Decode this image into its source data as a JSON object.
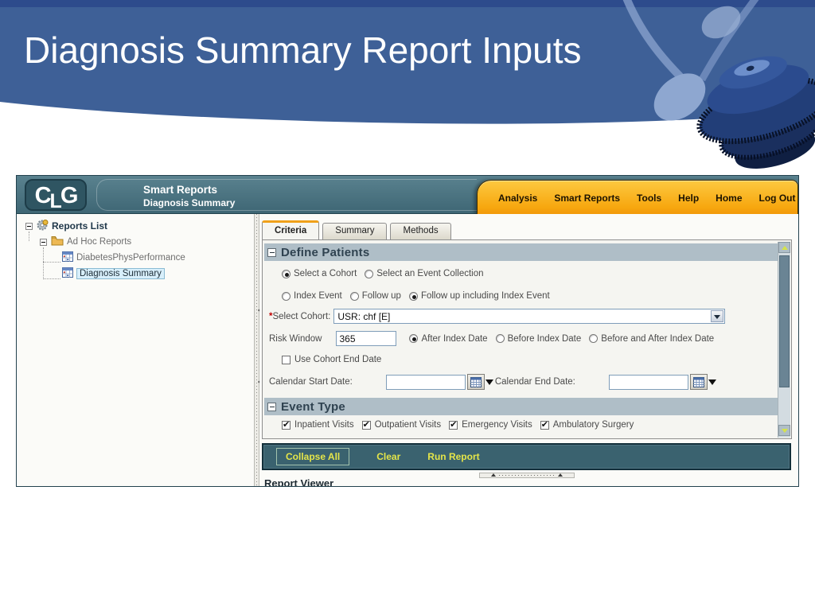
{
  "slide": {
    "title": "Diagnosis Summary Report Inputs"
  },
  "colors": {
    "banner_blue": "#3E6097",
    "banner_top_strip": "#2D4B8C",
    "header_teal": "#45707E",
    "nav_orange": "#F9A90F",
    "section_bar": "#AFBEC7",
    "action_bar": "#3A626F",
    "action_text_yellow": "#E5E549",
    "active_tab_accent": "#F0A11A",
    "tree_selection_bg": "#D8EFFB"
  },
  "app": {
    "logo": {
      "text": "CLG",
      "c": "C",
      "l": "L",
      "g": "G"
    },
    "header": {
      "product": "Smart Reports",
      "page": "Diagnosis Summary"
    },
    "nav_items": [
      {
        "label": "Analysis"
      },
      {
        "label": "Smart Reports"
      },
      {
        "label": "Tools"
      },
      {
        "label": "Help"
      },
      {
        "label": "Home"
      },
      {
        "label": "Log Out"
      }
    ],
    "tree": {
      "root": "Reports List",
      "folder": "Ad Hoc Reports",
      "items": [
        {
          "label": "DiabetesPhysPerformance",
          "selected": false
        },
        {
          "label": "Diagnosis Summary",
          "selected": true
        }
      ]
    },
    "tabs": [
      {
        "label": "Criteria",
        "active": true
      },
      {
        "label": "Summary",
        "active": false
      },
      {
        "label": "Methods",
        "active": false
      }
    ],
    "criteria": {
      "define_patients": {
        "heading": "Define Patients",
        "cohort_radios": [
          {
            "label": "Select a Cohort",
            "selected": true
          },
          {
            "label": "Select an Event Collection",
            "selected": false
          }
        ],
        "scope_radios": [
          {
            "label": "Index Event",
            "selected": false
          },
          {
            "label": "Follow up",
            "selected": false
          },
          {
            "label": "Follow up including Index Event",
            "selected": true
          }
        ],
        "select_cohort": {
          "required_mark": "*",
          "label": "Select Cohort:",
          "value": "USR: chf [E]"
        },
        "risk_window": {
          "label": "Risk Window",
          "value": "365",
          "radios": [
            {
              "label": "After Index Date",
              "selected": true
            },
            {
              "label": "Before Index Date",
              "selected": false
            },
            {
              "label": "Before and After Index Date",
              "selected": false
            }
          ]
        },
        "use_cohort_end_date": {
          "label": "Use Cohort End Date",
          "checked": false
        },
        "calendar_start": {
          "label": "Calendar Start Date:",
          "value": ""
        },
        "calendar_end": {
          "label": "Calendar End Date:",
          "value": ""
        }
      },
      "event_type": {
        "heading": "Event Type",
        "checkboxes": [
          {
            "label": "Inpatient Visits",
            "checked": true
          },
          {
            "label": "Outpatient Visits",
            "checked": true
          },
          {
            "label": "Emergency Visits",
            "checked": true
          },
          {
            "label": "Ambulatory Surgery",
            "checked": true
          }
        ]
      },
      "actions": [
        {
          "label": "Collapse All"
        },
        {
          "label": "Clear"
        },
        {
          "label": "Run Report"
        }
      ]
    },
    "report_viewer": {
      "heading": "Report Viewer"
    }
  }
}
